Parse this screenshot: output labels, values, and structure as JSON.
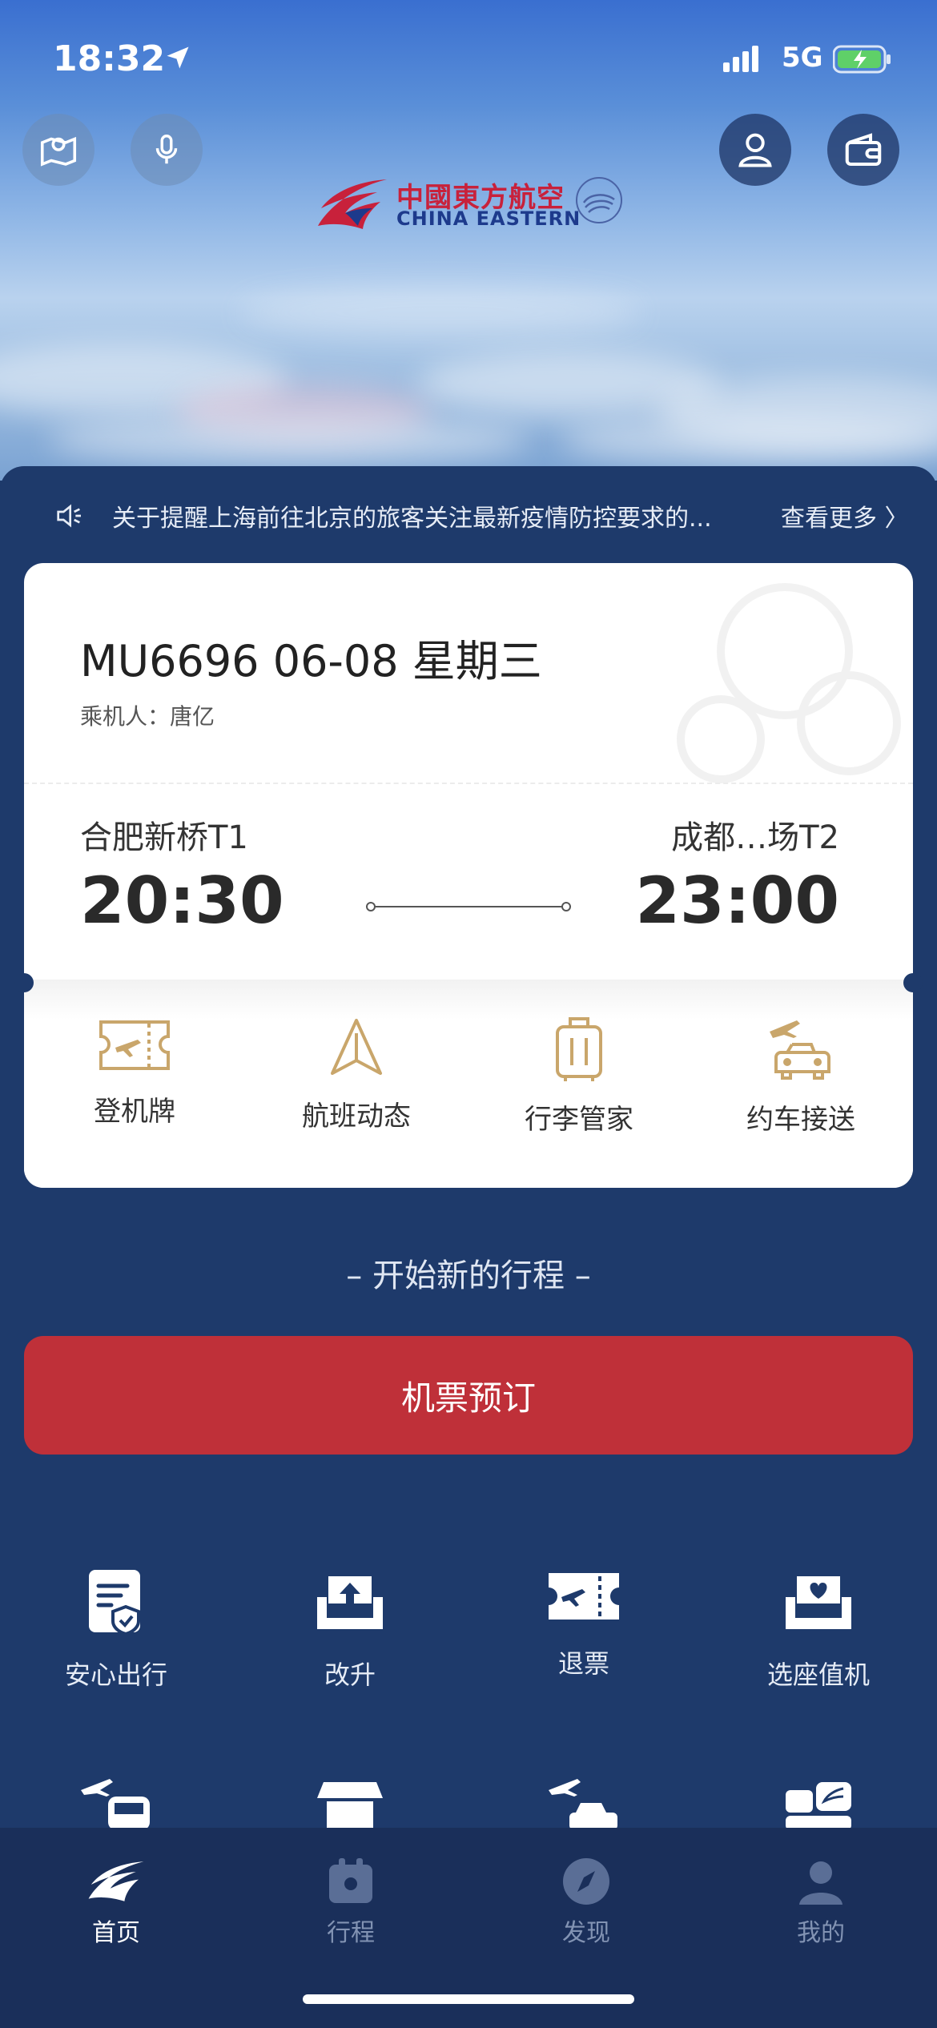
{
  "status_bar": {
    "time": "18:32",
    "network": "5G"
  },
  "header": {
    "logo_cn": "中國東方航空",
    "logo_en": "CHINA EASTERN",
    "brand_red": "#c8213b",
    "brand_blue": "#1d3a8c"
  },
  "notice": {
    "text": "关于提醒上海前往北京的旅客关注最新疫情防控要求的...",
    "more_label": "查看更多 〉"
  },
  "flight_card": {
    "title": "MU6696 06-08 星期三",
    "passenger": "乘机人：唐亿",
    "departure_airport": "合肥新桥T1",
    "departure_time": "20:30",
    "arrival_airport": "成都…场T2",
    "arrival_time": "23:00",
    "services": [
      {
        "label": "登机牌",
        "icon": "boarding-pass-icon"
      },
      {
        "label": "航班动态",
        "icon": "flight-status-icon"
      },
      {
        "label": "行李管家",
        "icon": "luggage-icon"
      },
      {
        "label": "约车接送",
        "icon": "car-transfer-icon"
      }
    ]
  },
  "new_trip": {
    "heading": "–  开始新的行程  –",
    "book_label": "机票预订",
    "book_color": "#bf3039"
  },
  "quick_actions": [
    {
      "label": "安心出行",
      "icon": "safe-travel-icon"
    },
    {
      "label": "改升",
      "icon": "upgrade-seat-icon"
    },
    {
      "label": "退票",
      "icon": "refund-ticket-icon"
    },
    {
      "label": "选座值机",
      "icon": "seat-checkin-icon"
    }
  ],
  "tab_bar": [
    {
      "label": "首页",
      "icon": "home-swallow-icon",
      "active": true
    },
    {
      "label": "行程",
      "icon": "itinerary-icon",
      "active": false
    },
    {
      "label": "发现",
      "icon": "discover-compass-icon",
      "active": false
    },
    {
      "label": "我的",
      "icon": "profile-icon",
      "active": false
    }
  ],
  "colors": {
    "panel": "#1e3a6b",
    "tabbar": "#1a2f5a",
    "accent_gold": "#c9a66b"
  }
}
